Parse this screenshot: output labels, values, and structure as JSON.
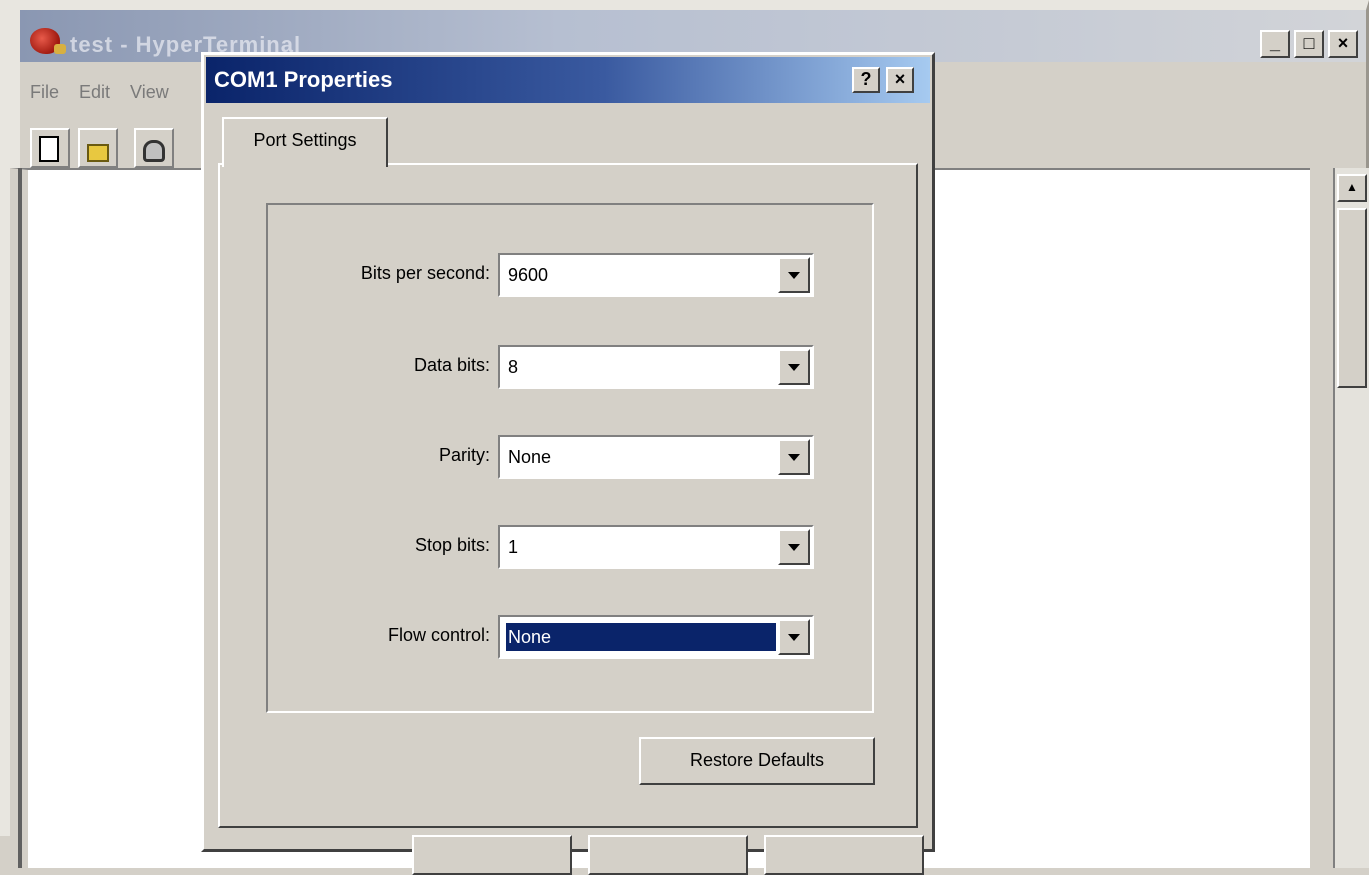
{
  "main_window": {
    "title": "test - HyperTerminal",
    "menu": [
      "File",
      "Edit",
      "View"
    ],
    "buttons": {
      "minimize": "_",
      "maximize": "□",
      "close": "×"
    },
    "icons": [
      "new-connection-icon",
      "open-icon",
      "phone-icon"
    ]
  },
  "dialog": {
    "title": "COM1 Properties",
    "help_label": "?",
    "close_label": "×",
    "tab_label": "Port Settings",
    "fields": [
      {
        "label": "Bits per second:",
        "value": "9600"
      },
      {
        "label": "Data bits:",
        "value": "8"
      },
      {
        "label": "Parity:",
        "value": "None"
      },
      {
        "label": "Stop bits:",
        "value": "1"
      },
      {
        "label": "Flow control:",
        "value": "None"
      }
    ],
    "restore_label": "Restore Defaults"
  },
  "colors": {
    "dialog_title_start": "#0a246a",
    "dialog_title_end": "#a6caf0",
    "selection": "#0a246a",
    "face": "#d4d0c8"
  }
}
